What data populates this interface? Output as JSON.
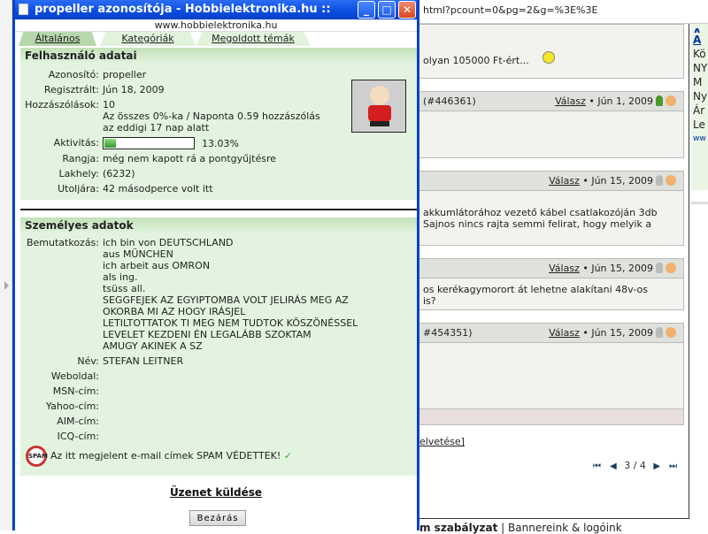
{
  "background": {
    "url": "html?pcount=0&pg=2&g=%3E%3E",
    "posts": [
      {
        "body": [
          "olyan 105000 Ft-ért..."
        ]
      },
      {
        "id": "(#446361)",
        "reply": "Válasz",
        "date": "Jún 1, 2009",
        "body": []
      },
      {
        "id": "",
        "reply": "Válasz",
        "date": "Jún 15, 2009",
        "body": [
          "akkumlátorához vezető kábel csatlakozóján 3db",
          "Sajnos nincs rajta semmi felirat, hogy melyik a"
        ]
      },
      {
        "id": "",
        "reply": "Válasz",
        "date": "Jún 15, 2009",
        "body": [
          "os kerékagymorort át lehetne alakítani 48v-os",
          "is?"
        ]
      },
      {
        "id": "#454351)",
        "reply": "Válasz",
        "date": "Jún 15, 2009",
        "body": []
      }
    ],
    "link_partial": "elvetése]",
    "pagination": {
      "current": "3 / 4"
    },
    "footer": {
      "bold": "m szabályzat",
      "rest": " | Bannereink & logóink"
    },
    "right_col": [
      "A",
      "A",
      "Kö",
      "NY",
      "M",
      "Ny",
      "Ár",
      "Le",
      "ww"
    ]
  },
  "popup": {
    "title": "propeller azonosítója - Hobbielektronika.hu ::",
    "site_url": "www.hobbielektronika.hu",
    "tabs": [
      {
        "label": "Általános",
        "active": true
      },
      {
        "label": "Kategóriák",
        "active": false
      },
      {
        "label": "Megoldott témák",
        "active": false
      }
    ],
    "user_section": {
      "title": "Felhasználó adatai",
      "id_label": "Azonosító:",
      "id": "propeller",
      "reg_label": "Regisztrált:",
      "reg": "Jún 18, 2009",
      "posts_label": "Hozzászólások:",
      "posts": "10",
      "posts_detail": "Az összes 0%-ka / Naponta 0.59 hozzászólás\naz eddigi 17 nap alatt",
      "activity_label": "Aktivitás:",
      "activity": "13.03%",
      "activity_value": 13.03,
      "rank_label": "Rangja:",
      "rank": "még nem kapott rá a pontgyűjtésre",
      "location_label": "Lakhely:",
      "location": "(6232)",
      "last_label": "Utoljára:",
      "last": "42 másodperce volt itt"
    },
    "personal_section": {
      "title": "Személyes adatok",
      "intro_label": "Bemutatkozás:",
      "intro": "ich bin von DEUTSCHLAND\naus MÜNCHEN\nich arbeit aus OMRON\nals ing.\ntsüss all.\nSEGGFEJEK AZ EGYIPTOMBA VOLT JELIRÁS MEG AZ\nOKORBA MI AZ HOGY IRÁSJEL\nLETILTOTTATOK TI MEG NEM TUDTOK KÖSZÖNÉSSEL\nLEVELET KEZDENI ÉN LEGALÁBB SZOKTAM\nAMUGY AKINEK A SZ",
      "name_label": "Név:",
      "name": "STEFAN LEITNER",
      "web_label": "Weboldal:",
      "msn_label": "MSN-cím:",
      "yahoo_label": "Yahoo-cím:",
      "aim_label": "AIM-cím:",
      "icq_label": "ICQ-cím:",
      "spam_icon_text": "SPAM",
      "spam_note": "Az itt megjelent e-mail címek SPAM VÉDETTEK!",
      "check": "✓"
    },
    "send_message": "Üzenet küldése",
    "close_button": "Bezárás"
  }
}
